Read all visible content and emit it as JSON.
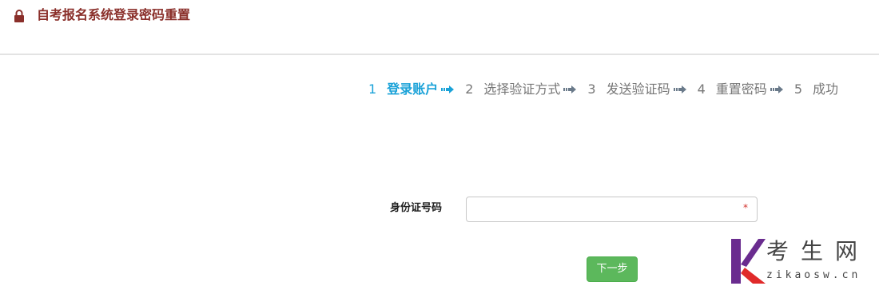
{
  "header": {
    "title": "自考报名系统登录密码重置"
  },
  "steps": [
    {
      "num": "1",
      "label": "登录账户"
    },
    {
      "num": "2",
      "label": "选择验证方式"
    },
    {
      "num": "3",
      "label": "发送验证码"
    },
    {
      "num": "4",
      "label": "重置密码"
    },
    {
      "num": "5",
      "label": "成功"
    }
  ],
  "active_step": 1,
  "form": {
    "id_label": "身份证号码",
    "id_value": "",
    "required_mark": "*",
    "next_label": "下一步"
  },
  "watermark": {
    "cn": "考生网",
    "en": "zikaosw.cn"
  },
  "colors": {
    "title": "#8a2f2a",
    "active_step": "#1aa2d8",
    "inactive_step": "#777777",
    "next_button": "#5cb85c",
    "watermark_k_purple": "#6a2c8f",
    "watermark_k_red": "#e02a2a"
  }
}
